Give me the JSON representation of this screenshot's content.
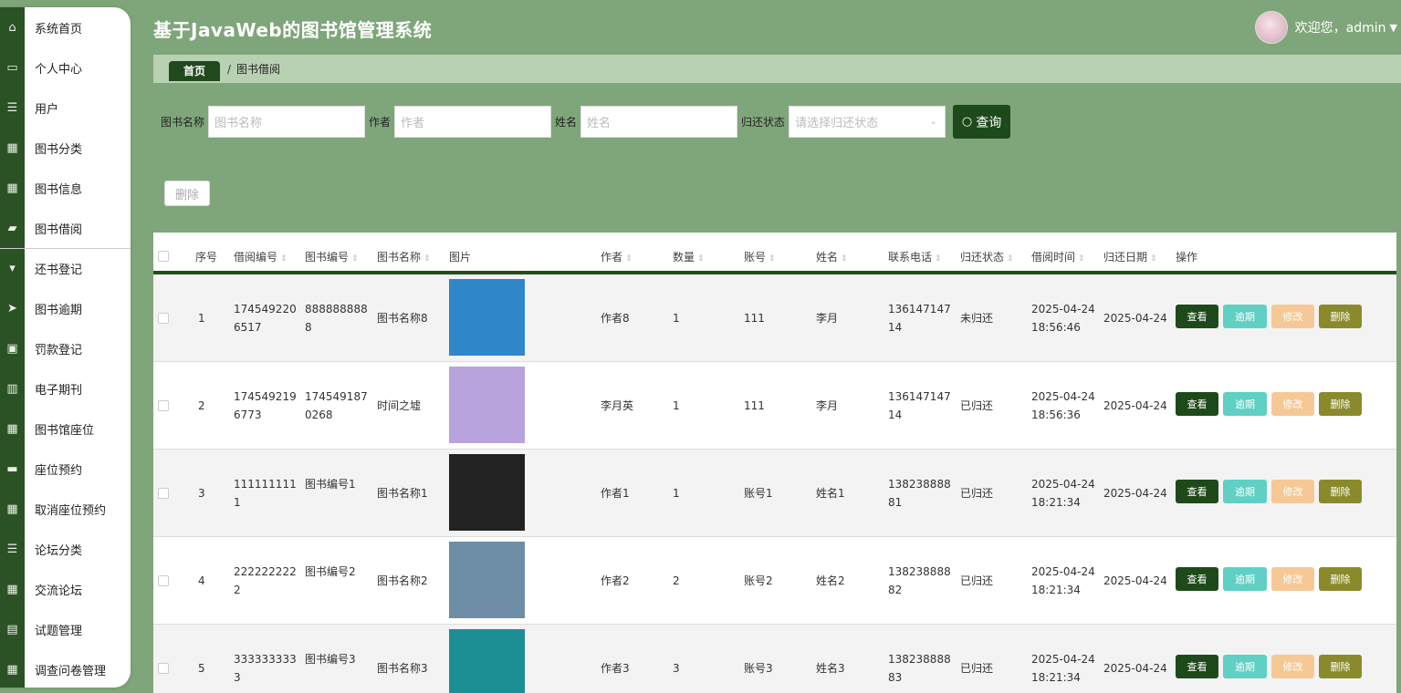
{
  "app_title": "基于JavaWeb的图书馆管理系统",
  "user": {
    "welcome": "欢迎您，admin"
  },
  "sidebar": {
    "items": [
      {
        "label": "系统首页",
        "icon": "home-icon",
        "glyph": "⌂"
      },
      {
        "label": "个人中心",
        "icon": "id-card-icon",
        "glyph": "▭"
      },
      {
        "label": "用户",
        "icon": "list-icon",
        "glyph": "☰"
      },
      {
        "label": "图书分类",
        "icon": "grid-icon",
        "glyph": "▦"
      },
      {
        "label": "图书信息",
        "icon": "grid-icon",
        "glyph": "▦"
      },
      {
        "label": "图书借阅",
        "icon": "briefcase-icon",
        "glyph": "▰"
      },
      {
        "label": "还书登记",
        "icon": "stand-icon",
        "glyph": "▾"
      },
      {
        "label": "图书逾期",
        "icon": "send-icon",
        "glyph": "➤"
      },
      {
        "label": "罚款登记",
        "icon": "clipboard-check-icon",
        "glyph": "▣"
      },
      {
        "label": "电子期刊",
        "icon": "book-icon",
        "glyph": "▥"
      },
      {
        "label": "图书馆座位",
        "icon": "grid-icon",
        "glyph": "▦"
      },
      {
        "label": "座位预约",
        "icon": "ticket-icon",
        "glyph": "▬"
      },
      {
        "label": "取消座位预约",
        "icon": "grid-icon",
        "glyph": "▦"
      },
      {
        "label": "论坛分类",
        "icon": "list-icon",
        "glyph": "☰"
      },
      {
        "label": "交流论坛",
        "icon": "grid-icon",
        "glyph": "▦"
      },
      {
        "label": "试题管理",
        "icon": "clipboard-icon",
        "glyph": "▤"
      },
      {
        "label": "调查问卷管理",
        "icon": "grid-icon",
        "glyph": "▦"
      }
    ]
  },
  "breadcrumb": {
    "home": "首页",
    "separator": "/",
    "current": "图书借阅"
  },
  "search": {
    "book_name": {
      "label": "图书名称",
      "placeholder": "图书名称"
    },
    "author": {
      "label": "作者",
      "placeholder": "作者"
    },
    "name": {
      "label": "姓名",
      "placeholder": "姓名"
    },
    "status": {
      "label": "归还状态",
      "placeholder": "请选择归还状态"
    },
    "query_button": "查询"
  },
  "batch_delete": "删除",
  "table": {
    "headers": {
      "no": "序号",
      "borrow_no": "借阅编号",
      "book_no": "图书编号",
      "book_name": "图书名称",
      "image": "图片",
      "author": "作者",
      "qty": "数量",
      "account": "账号",
      "name": "姓名",
      "phone": "联系电话",
      "status": "归还状态",
      "borrow_time": "借阅时间",
      "return_date": "归还日期",
      "ops": "操作"
    },
    "actions": {
      "view": "查看",
      "overdue": "逾期",
      "edit": "修改",
      "delete": "删除"
    },
    "rows": [
      {
        "no": "1",
        "borrow_no": "1745492206517",
        "book_no": "8888888888",
        "book_name": "图书名称8",
        "author": "作者8",
        "qty": "1",
        "account": "111",
        "name": "李月",
        "phone": "13614714714",
        "status": "未归还",
        "borrow_time": "2025-04-24 18:56:46",
        "return_date": "2025-04-24",
        "cover_color": "#2f86c9"
      },
      {
        "no": "2",
        "borrow_no": "1745492196773",
        "book_no": "1745491870268",
        "book_name": "时间之墟",
        "author": "李月英",
        "qty": "1",
        "account": "111",
        "name": "李月",
        "phone": "13614714714",
        "status": "已归还",
        "borrow_time": "2025-04-24 18:56:36",
        "return_date": "2025-04-24",
        "cover_color": "#b9a3dc"
      },
      {
        "no": "3",
        "borrow_no": "1111111111",
        "book_no": "图书编号1",
        "book_name": "图书名称1",
        "author": "作者1",
        "qty": "1",
        "account": "账号1",
        "name": "姓名1",
        "phone": "13823888881",
        "status": "已归还",
        "borrow_time": "2025-04-24 18:21:34",
        "return_date": "2025-04-24",
        "cover_color": "#222222"
      },
      {
        "no": "4",
        "borrow_no": "2222222222",
        "book_no": "图书编号2",
        "book_name": "图书名称2",
        "author": "作者2",
        "qty": "2",
        "account": "账号2",
        "name": "姓名2",
        "phone": "13823888882",
        "status": "已归还",
        "borrow_time": "2025-04-24 18:21:34",
        "return_date": "2025-04-24",
        "cover_color": "#6d8ea6"
      },
      {
        "no": "5",
        "borrow_no": "3333333333",
        "book_no": "图书编号3",
        "book_name": "图书名称3",
        "author": "作者3",
        "qty": "3",
        "account": "账号3",
        "name": "姓名3",
        "phone": "13823888883",
        "status": "已归还",
        "borrow_time": "2025-04-24 18:21:34",
        "return_date": "2025-04-24",
        "cover_color": "#1c8f95"
      }
    ]
  }
}
